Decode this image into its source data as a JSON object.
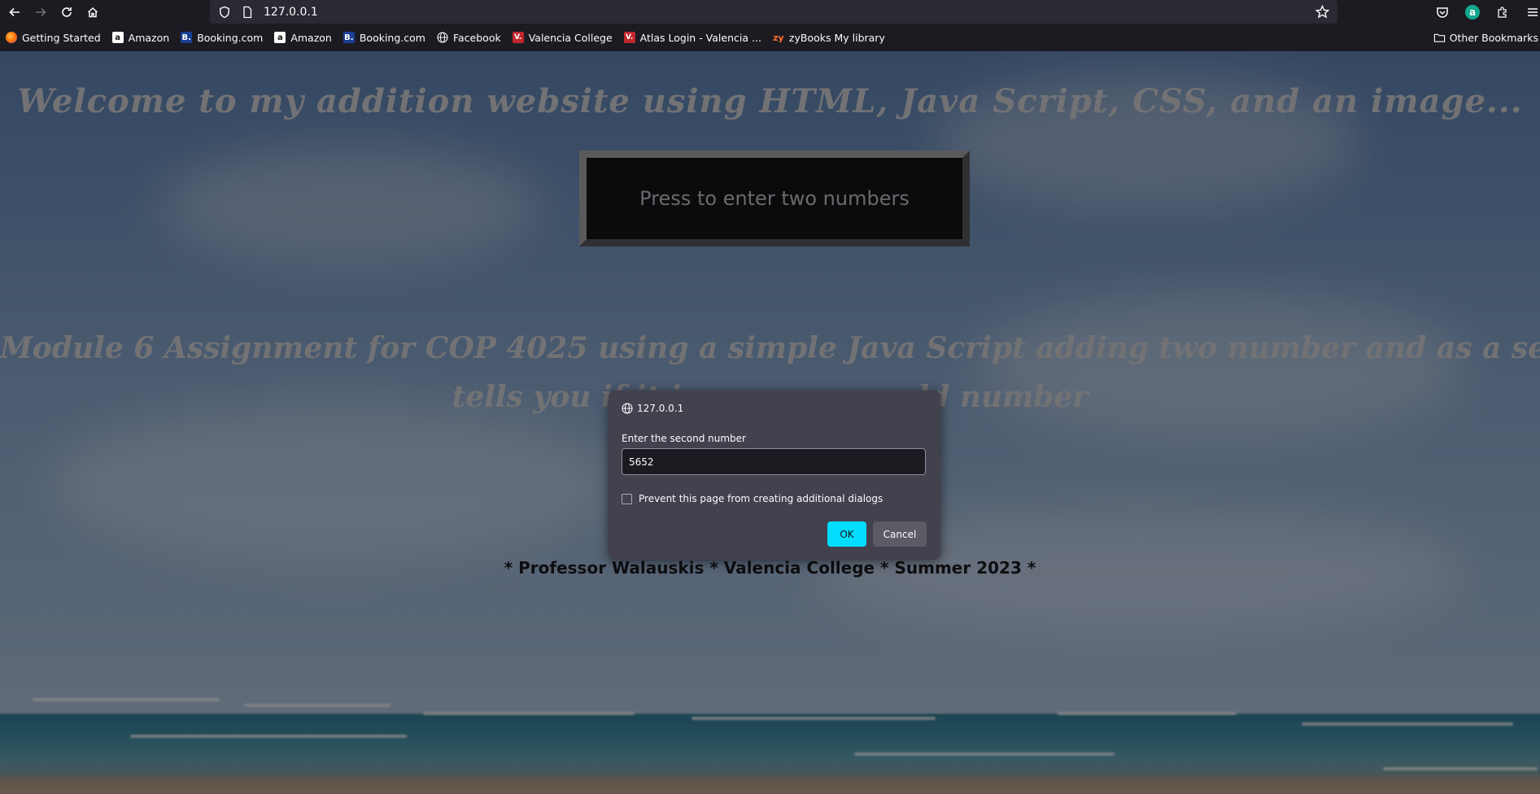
{
  "browser": {
    "url": "127.0.0.1",
    "nav": {
      "back_icon": "arrow-left-icon",
      "forward_icon": "arrow-right-icon",
      "reload_icon": "reload-icon",
      "home_icon": "home-icon"
    },
    "toolbar_right": {
      "pocket_icon": "pocket-icon",
      "account_initial": "a",
      "extensions_icon": "puzzle-icon",
      "menu_icon": "hamburger-menu-icon"
    },
    "bookmarks": [
      {
        "label": "Getting Started",
        "icon": "firefox-icon"
      },
      {
        "label": "Amazon",
        "icon": "amazon-icon"
      },
      {
        "label": "Booking.com",
        "icon": "booking-icon"
      },
      {
        "label": "Amazon",
        "icon": "amazon-icon"
      },
      {
        "label": "Booking.com",
        "icon": "booking-icon"
      },
      {
        "label": "Facebook",
        "icon": "globe-icon"
      },
      {
        "label": "Valencia College",
        "icon": "valencia-icon"
      },
      {
        "label": "Atlas Login - Valencia ...",
        "icon": "valencia-icon"
      },
      {
        "label": "zyBooks My library",
        "icon": "zybooks-icon"
      }
    ],
    "other_bookmarks": "Other Bookmarks"
  },
  "page": {
    "welcome": "Welcome to my addition website using HTML, Java Script, CSS, and an image...",
    "press_button": "Press to enter two numbers",
    "module_line1": "Module 6 Assignment for COP 4025 using a simple Java Script adding two number and as a second feature",
    "module_line2": "tells you if it is an even or odd number",
    "footer": "* Professor Walauskis * Valencia College * Summer 2023 *"
  },
  "dialog": {
    "origin": "127.0.0.1",
    "message": "Enter the second number",
    "input_value": "5652",
    "checkbox_label": "Prevent this page from creating additional dialogs",
    "ok_label": "OK",
    "cancel_label": "Cancel"
  },
  "colors": {
    "ok_button": "#00ddff",
    "dialog_bg": "#42414d",
    "chrome_bg": "#1c1b22"
  }
}
